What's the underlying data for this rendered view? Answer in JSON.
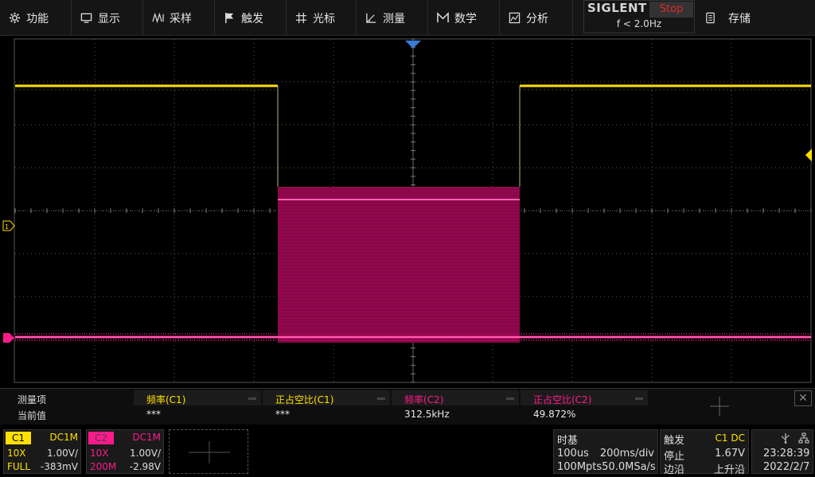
{
  "menu": {
    "function": "功能",
    "display": "显示",
    "acquire": "采样",
    "trigger": "触发",
    "cursors": "光标",
    "measure": "测量",
    "math": "数学",
    "analysis": "分析",
    "storage": "存储"
  },
  "status": {
    "brand": "SIGLENT",
    "run_state": "Stop",
    "trigger_freq": "f < 2.0Hz"
  },
  "measurements": {
    "row_header": "测量项",
    "row_value_label": "当前值",
    "items": [
      {
        "name": "频率(C1)",
        "value": "***",
        "color": "#ffe000"
      },
      {
        "name": "正占空比(C1)",
        "value": "***",
        "color": "#ffe000"
      },
      {
        "name": "频率(C2)",
        "value": "312.5kHz",
        "color": "#ff1a8c"
      },
      {
        "name": "正占空比(C2)",
        "value": "49.872%",
        "color": "#ff1a8c"
      }
    ]
  },
  "channels": {
    "c1": {
      "label": "C1",
      "coupling": "DC1M",
      "probe": "10X",
      "scale": "1.00V/",
      "bandwidth": "FULL",
      "offset": "-383mV",
      "color": "#ffe000"
    },
    "c2": {
      "label": "C2",
      "coupling": "DC1M",
      "probe": "10X",
      "scale": "1.00V/",
      "bandwidth": "200M",
      "offset": "-2.98V",
      "color": "#ff1a8c"
    }
  },
  "timebase": {
    "title": "时基",
    "delay": "100us",
    "scale": "200ms/div",
    "memory": "100Mpts",
    "sample_rate": "50.0MSa/s"
  },
  "trigger": {
    "title": "触发",
    "source": "C1 DC",
    "mode": "停止",
    "level": "1.67V",
    "type": "边沿",
    "slope": "上升沿"
  },
  "clock": {
    "time": "23:28:39",
    "date": "2022/2/7"
  },
  "colors": {
    "ch1": "#ffe000",
    "ch2": "#ff1a8c",
    "trigger_marker": "#3a7bd5",
    "grid": "#5a5a5a"
  }
}
